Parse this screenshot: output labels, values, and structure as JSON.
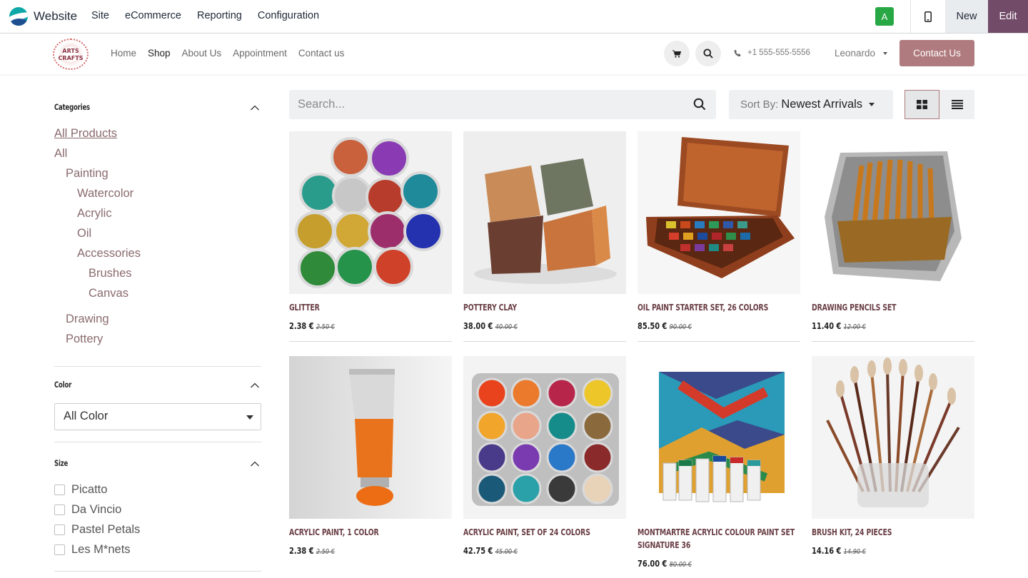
{
  "admin_bar": {
    "app_name": "Website",
    "menu": [
      "Site",
      "eCommerce",
      "Reporting",
      "Configuration"
    ],
    "avatar_letter": "A",
    "new_label": "New",
    "edit_label": "Edit"
  },
  "site": {
    "logo_line1": "ARTS",
    "logo_line2": "CRAFTS",
    "nav": [
      "Home",
      "Shop",
      "About Us",
      "Appointment",
      "Contact us"
    ],
    "active_nav": "Shop",
    "phone": "+1 555-555-5556",
    "user": "Leonardo",
    "contact_button": "Contact Us"
  },
  "sidebar": {
    "categories_title": "Categories",
    "categories": [
      {
        "label": "All Products",
        "level": 0,
        "underline": true
      },
      {
        "label": "All",
        "level": 0
      },
      {
        "label": "Painting",
        "level": 1
      },
      {
        "label": "Watercolor",
        "level": 2
      },
      {
        "label": "Acrylic",
        "level": 2
      },
      {
        "label": "Oil",
        "level": 2
      },
      {
        "label": "Accessories",
        "level": 2
      },
      {
        "label": "Brushes",
        "level": 3
      },
      {
        "label": "Canvas",
        "level": 3
      },
      {
        "label": "Drawing",
        "level": 1
      },
      {
        "label": "Pottery",
        "level": 1
      }
    ],
    "color_title": "Color",
    "color_selected": "All Color",
    "size_title": "Size",
    "sizes": [
      "Picatto",
      "Da Vincio",
      "Pastel Petals",
      "Les M*nets"
    ]
  },
  "toolbar": {
    "search_placeholder": "Search...",
    "sort_label": "Sort By:",
    "sort_value": "Newest Arrivals"
  },
  "products": [
    {
      "name": "Glitter",
      "price": "2.38 €",
      "old_price": "2.50 €",
      "image": "glitter-jars"
    },
    {
      "name": "Pottery Clay",
      "price": "38.00 €",
      "old_price": "40.00 €",
      "image": "clay-blocks"
    },
    {
      "name": "Oil Paint Starter Set, 26 Colors",
      "price": "85.50 €",
      "old_price": "90.00 €",
      "image": "paint-box"
    },
    {
      "name": "Drawing Pencils Set",
      "price": "11.40 €",
      "old_price": "12.00 €",
      "image": "pencil-tin"
    },
    {
      "name": "Acrylic Paint, 1 Color",
      "price": "2.38 €",
      "old_price": "2.50 €",
      "image": "paint-tube"
    },
    {
      "name": "Acrylic Paint, Set of 24 Colors",
      "price": "42.75 €",
      "old_price": "45.00 €",
      "image": "paint-pots"
    },
    {
      "name": "Montmartre Acrylic Colour Paint Set Signature 36",
      "price": "76.00 €",
      "old_price": "80.00 €",
      "image": "acrylic-set"
    },
    {
      "name": "Brush Kit, 24 Pieces",
      "price": "14.16 €",
      "old_price": "14.90 €",
      "image": "brush-jar"
    }
  ],
  "colors": {
    "brand": "#714b67",
    "accent": "#b07b7e",
    "product_name": "#6a3f45",
    "category_link": "#8a6a6e"
  }
}
